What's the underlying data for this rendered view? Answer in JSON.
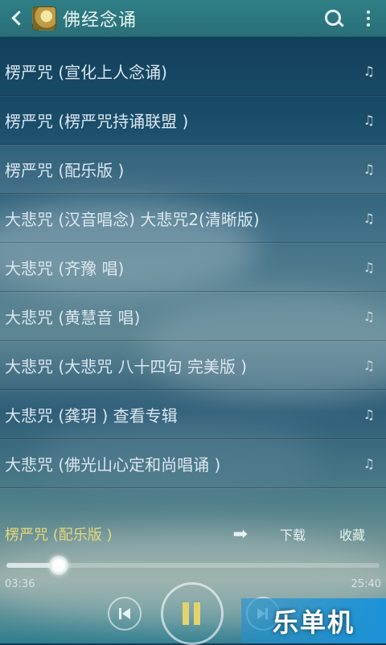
{
  "header": {
    "title": "佛经念诵",
    "icons": {
      "back": "back-icon",
      "app": "app-icon",
      "search": "search-icon",
      "more": "more-vert-icon"
    }
  },
  "tracks": [
    {
      "title": "楞严咒 (宣化上人念诵)"
    },
    {
      "title": "楞严咒 (楞严咒持诵联盟 )"
    },
    {
      "title": "楞严咒 (配乐版 )"
    },
    {
      "title": "大悲咒 (汉音唱念) 大悲咒2(清晰版)"
    },
    {
      "title": "大悲咒 (齐豫 唱)"
    },
    {
      "title": "大悲咒 (黄慧音 唱)"
    },
    {
      "title": "大悲咒 (大悲咒 八十四句 完美版 )"
    },
    {
      "title": "大悲咒 (龚玥 ) 查看专辑"
    },
    {
      "title": "大悲咒 (佛光山心定和尚唱诵 )"
    }
  ],
  "note_symbol": "♫",
  "now_playing": {
    "title": "楞严咒 (配乐版 )",
    "arrow": "➡",
    "download_label": "下载",
    "favorite_label": "收藏"
  },
  "player": {
    "elapsed": "03:36",
    "duration": "25:40",
    "progress_fraction": 0.14
  },
  "watermark": "乐单机",
  "colors": {
    "accent": "#e4d77b",
    "header": "#2f7f86",
    "watermark": "#1c93d8"
  }
}
